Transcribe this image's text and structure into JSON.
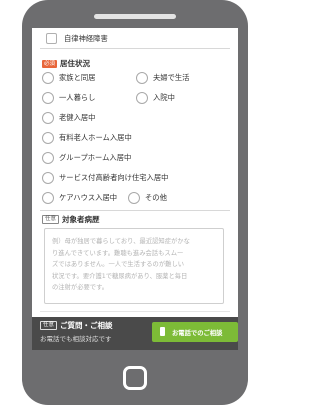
{
  "form": {
    "autonomic_label": "自律神経障害",
    "residence": {
      "badge": "必須",
      "label": "居住状況",
      "options": [
        "家族と同居",
        "夫婦で生活",
        "一人暮らし",
        "入院中",
        "老健入居中",
        "有料老人ホーム入居中",
        "グループホーム入居中",
        "サービス付高齢者向け住宅入居中",
        "ケアハウス入居中",
        "その他"
      ]
    },
    "medical_history": {
      "badge": "任意",
      "label": "対象者病歴",
      "placeholder_lines": [
        "例）母が独居で暮らしており、最近認知症がかな",
        "り進んできています。難聴も進み会話もスムー",
        "ズではありません。一人で生活するのが難しい",
        "状況です。要介護1で糖尿病があり、服薬と毎日",
        "の注射が必要です。"
      ]
    }
  },
  "footer": {
    "badge": "任意",
    "label": "ご質問・ご相談",
    "cutoff_text": "お電話でも相談対応です",
    "tel_button": "お電話でのご相談"
  }
}
